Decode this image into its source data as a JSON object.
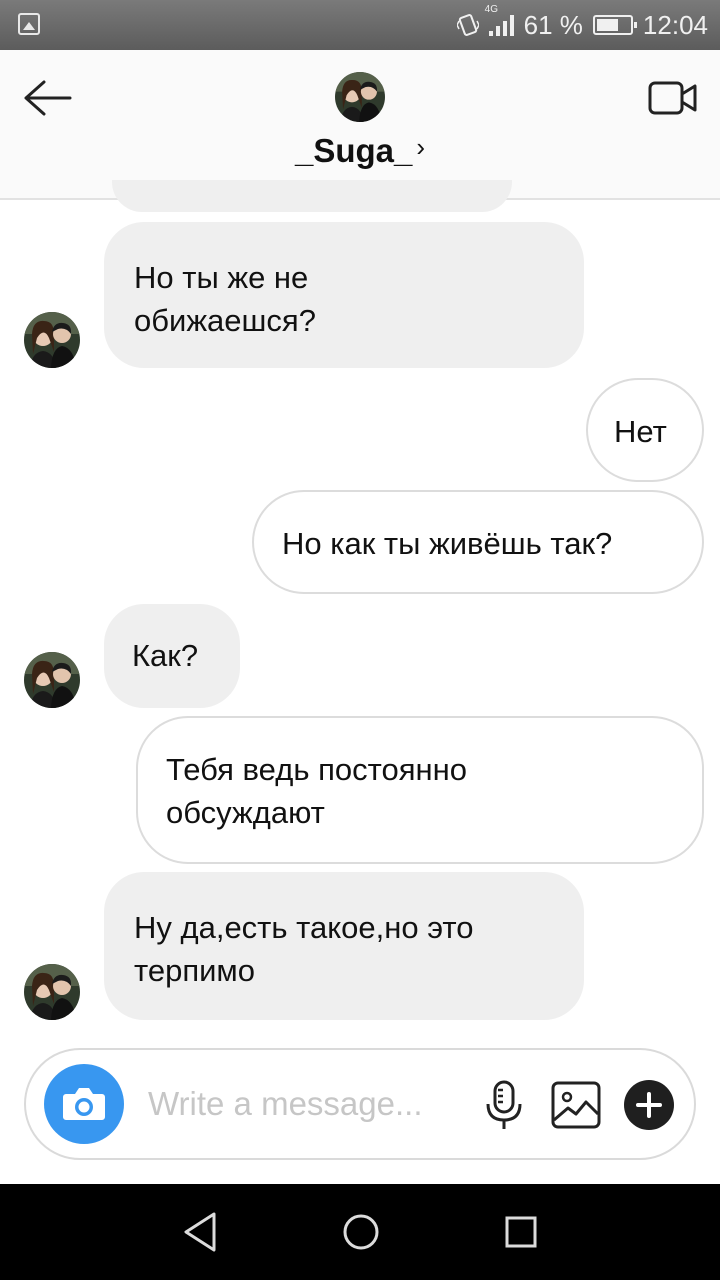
{
  "status_bar": {
    "network_label": "4G",
    "battery": "61 %",
    "time": "12:04",
    "icons": [
      "gallery-notification-icon",
      "vibrate-icon",
      "signal-icon",
      "battery-icon"
    ]
  },
  "header": {
    "username": "_Suga_",
    "chevron": "›",
    "icons": {
      "back": "arrow-left-icon",
      "video": "video-camera-icon"
    }
  },
  "messages": [
    {
      "direction": "in",
      "lines": [
        "Но ты же не",
        "обижаешся?"
      ]
    },
    {
      "direction": "out",
      "lines": [
        "Нет"
      ]
    },
    {
      "direction": "out",
      "lines": [
        "Но как ты живёшь так?"
      ]
    },
    {
      "direction": "in",
      "lines": [
        "Как?"
      ]
    },
    {
      "direction": "out",
      "lines": [
        "Тебя ведь постоянно",
        "обсуждают"
      ]
    },
    {
      "direction": "in",
      "lines": [
        "Ну да,есть такое,но это",
        "терпимо"
      ]
    }
  ],
  "composer": {
    "placeholder": "Write a message...",
    "value": "",
    "icons": [
      "camera-icon",
      "microphone-icon",
      "gallery-icon",
      "plus-icon"
    ]
  },
  "colors": {
    "accent": "#3897f0",
    "incoming_bubble": "#efefef",
    "outgoing_border": "#dcdcdc",
    "status_bar": "#6b6b6b",
    "nav_bar": "#000000"
  },
  "nav_bar": {
    "icons": [
      "back-triangle-icon",
      "home-circle-icon",
      "recents-square-icon"
    ]
  }
}
